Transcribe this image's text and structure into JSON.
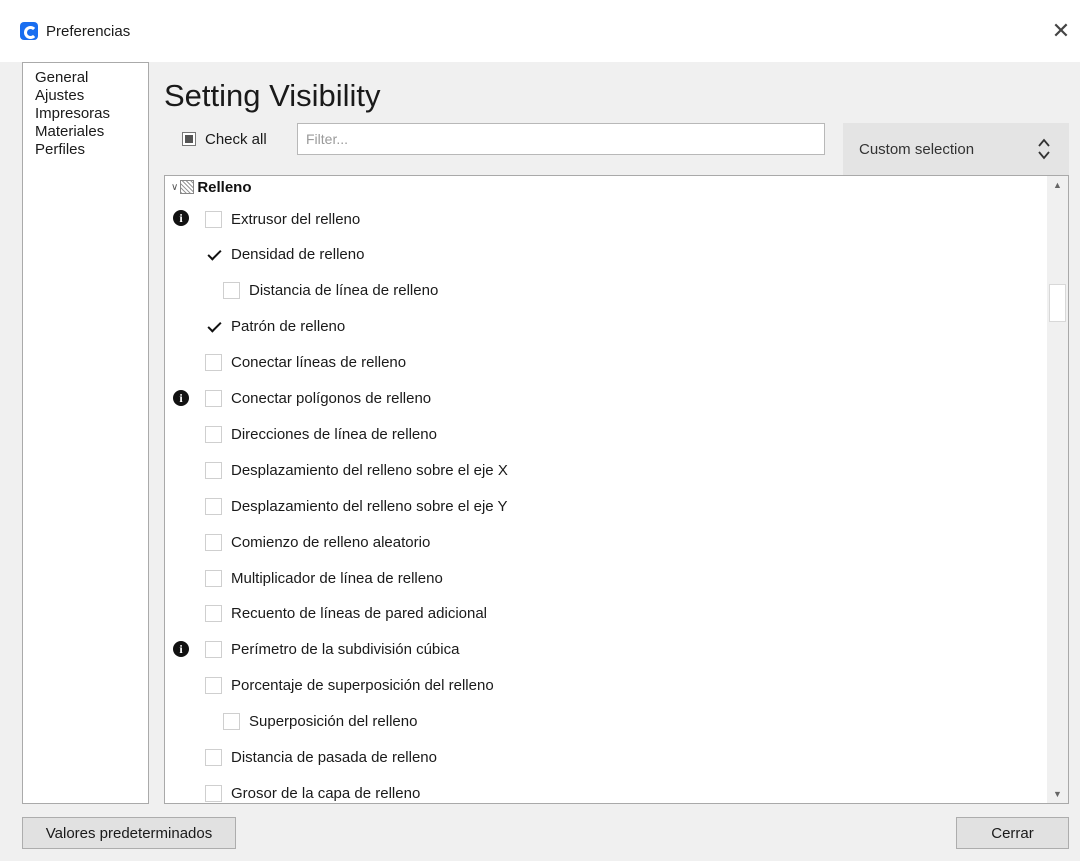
{
  "window": {
    "title": "Preferencias",
    "close_symbol": "✕",
    "icon": "app-logo-icon"
  },
  "sidebar": {
    "items": [
      {
        "label": "General"
      },
      {
        "label": "Ajustes"
      },
      {
        "label": "Impresoras"
      },
      {
        "label": "Materiales"
      },
      {
        "label": "Perfiles"
      }
    ]
  },
  "page": {
    "heading": "Setting Visibility"
  },
  "toolbar": {
    "check_all_label": "Check all",
    "check_all_state": "partial",
    "filter_placeholder": "Filter...",
    "filter_value": "",
    "preset_selected": "Custom selection"
  },
  "settings": {
    "category": {
      "label": "Relleno",
      "expanded": true
    },
    "items": [
      {
        "label": "Extrusor del relleno",
        "checked": false,
        "info": true,
        "indent": 0
      },
      {
        "label": "Densidad de relleno",
        "checked": true,
        "info": false,
        "indent": 0
      },
      {
        "label": "Distancia de línea de relleno",
        "checked": false,
        "info": false,
        "indent": 1
      },
      {
        "label": "Patrón de relleno",
        "checked": true,
        "info": false,
        "indent": 0
      },
      {
        "label": "Conectar líneas de relleno",
        "checked": false,
        "info": false,
        "indent": 0
      },
      {
        "label": "Conectar polígonos de relleno",
        "checked": false,
        "info": true,
        "indent": 0
      },
      {
        "label": "Direcciones de línea de relleno",
        "checked": false,
        "info": false,
        "indent": 0
      },
      {
        "label": "Desplazamiento del relleno sobre el eje X",
        "checked": false,
        "info": false,
        "indent": 0
      },
      {
        "label": "Desplazamiento del relleno sobre el eje Y",
        "checked": false,
        "info": false,
        "indent": 0
      },
      {
        "label": "Comienzo de relleno aleatorio",
        "checked": false,
        "info": false,
        "indent": 0
      },
      {
        "label": "Multiplicador de línea de relleno",
        "checked": false,
        "info": false,
        "indent": 0
      },
      {
        "label": "Recuento de líneas de pared adicional",
        "checked": false,
        "info": false,
        "indent": 0
      },
      {
        "label": "Perímetro de la subdivisión cúbica",
        "checked": false,
        "info": true,
        "indent": 0
      },
      {
        "label": "Porcentaje de superposición del relleno",
        "checked": false,
        "info": false,
        "indent": 0
      },
      {
        "label": "Superposición del relleno",
        "checked": false,
        "info": false,
        "indent": 1
      },
      {
        "label": "Distancia de pasada de relleno",
        "checked": false,
        "info": false,
        "indent": 0
      },
      {
        "label": "Grosor de la capa de relleno",
        "checked": false,
        "info": false,
        "indent": 0
      }
    ]
  },
  "buttons": {
    "defaults_label": "Valores predeterminados",
    "close_label": "Cerrar"
  },
  "colors": {
    "accent": "#196ef0",
    "window_bg": "#f0f0f0",
    "panel_bg": "#ffffff"
  }
}
